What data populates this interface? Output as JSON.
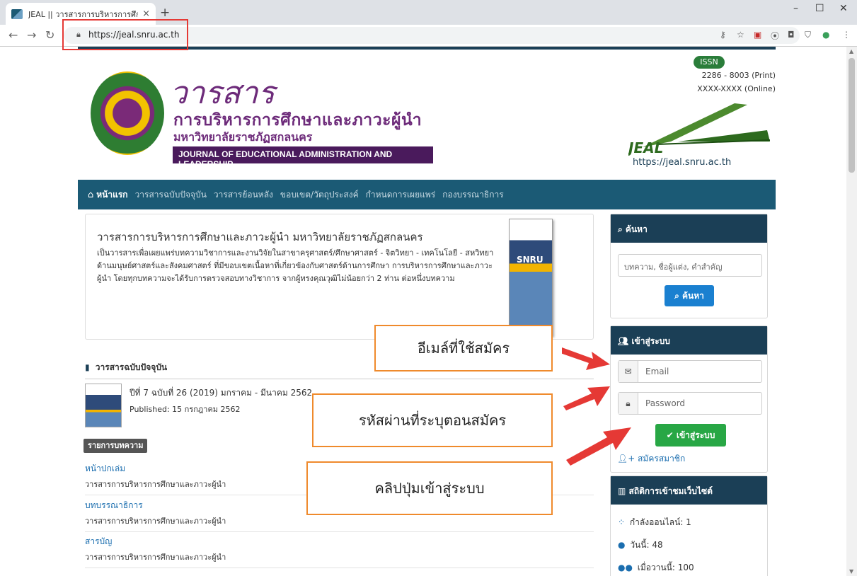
{
  "browser": {
    "tab_title": "JEAL || วารสารการบริหารการศึกษาและ",
    "tab_close": "×",
    "new_tab": "+",
    "url": "https://jeal.snru.ac.th",
    "window_controls": [
      "–",
      "☐",
      "✕"
    ]
  },
  "header": {
    "logo_script": "วารสาร",
    "logo_thai": "การบริหารการศึกษาและภาวะผู้นำ",
    "logo_university": "มหาวิทยาลัยราชภัฏสกลนคร",
    "journal_english": "JOURNAL OF EDUCATIONAL ADMINISTRATION AND LEADERSHIP",
    "issn_label": "ISSN",
    "issn_print": "2286 - 8003 (Print)",
    "issn_online": "XXXX-XXXX (Online)",
    "jeal_logo_text": "JEAL",
    "site_url": "https://jeal.snru.ac.th"
  },
  "nav": {
    "items": [
      "หน้าแรก",
      "วารสารฉบับปัจจุบัน",
      "วารสารย้อนหลัง",
      "ขอบเขต/วัตถุประสงค์",
      "กำหนดการเผยแพร่",
      "กองบรรณาธิการ"
    ]
  },
  "intro": {
    "title": "วารสารการบริหารการศึกษาและภาวะผู้นำ มหาวิทยาลัยราชภัฏสกลนคร",
    "description": "เป็นวารสารเพื่อเผยแพร่บทความวิชาการและงานวิจัยในสาขาครุศาสตร์/ศึกษาศาสตร์ - จิตวิทยา - เทคโนโลยี - สหวิทยาด้านมนุษย์ศาสตร์และสังคมศาสตร์ ที่มีขอบเขตเนื้อหาที่เกี่ยวข้องกับศาสตร์ด้านการศึกษา การบริหารการศึกษาและภาวะผู้นำ โดยทุกบทความจะได้รับการตรวจสอบทางวิชาการ จากผู้ทรงคุณวุฒิไม่น้อยกว่า 2 ท่าน ต่อหนึ่งบทความ",
    "cover_text": "SNRU"
  },
  "current_issue": {
    "heading": "วารสารฉบับปัจจุบัน",
    "title": "ปีที่ 7 ฉบับที่ 26 (2019) มกราคม - มีนาคม 2562",
    "published": "Published: 15 กรกฎาคม 2562",
    "toc_label": "รายการบทความ",
    "items": [
      {
        "title": "หน้าปกเล่ม",
        "subtitle": "วารสารการบริหารการศึกษาและภาวะผู้นำ"
      },
      {
        "title": "บทบรรณาธิการ",
        "subtitle": "วารสารการบริหารการศึกษาและภาวะผู้นำ"
      },
      {
        "title": "สารบัญ",
        "subtitle": "วารสารการบริหารการศึกษาและภาวะผู้นำ"
      }
    ]
  },
  "sidebar": {
    "search": {
      "heading": "ค้นหา",
      "placeholder": "บทความ, ชื่อผู้แต่ง, คำสำคัญ",
      "button": "ค้นหา"
    },
    "login": {
      "heading": "เข้าสู่ระบบ",
      "email_placeholder": "Email",
      "password_placeholder": "Password",
      "button": "เข้าสู่ระบบ",
      "register": "สมัครสมาชิก"
    },
    "stats": {
      "heading": "สถิติการเข้าชมเว็บไซต์",
      "online": "กำลังออนไลน์: 1",
      "today": "วันนี้: 48",
      "yesterday": "เมื่อวานนี้: 100"
    }
  },
  "annotations": {
    "email_callout": "อีเมล์ที่ใช้สมัคร",
    "password_callout": "รหัสผ่านที่ระบุตอนสมัคร",
    "button_callout": "คลิปปุ่มเข้าสู่ระบบ"
  },
  "colors": {
    "nav": "#1b5a75",
    "card_head": "#1b3f56",
    "login_button": "#28a745",
    "search_button": "#1a80d0",
    "callout_border": "#ef8a2c",
    "arrow": "#e53935"
  }
}
